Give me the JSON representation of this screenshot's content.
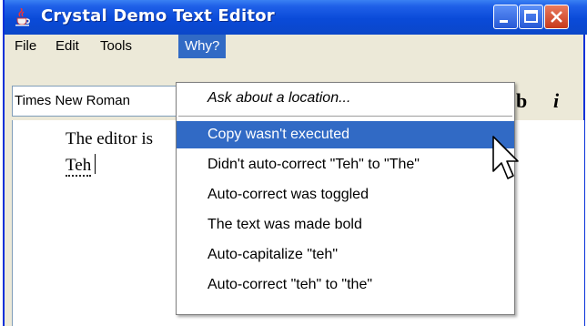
{
  "window": {
    "title": "Crystal Demo Text Editor",
    "app_icon": "java-cup-icon"
  },
  "menubar": {
    "items": [
      "File",
      "Edit",
      "Tools",
      "Why?"
    ],
    "active": "Why?"
  },
  "toolbar": {
    "font_value": "Times New Roman",
    "bold_label": "b",
    "italic_label": "i"
  },
  "editor": {
    "line1": "The editor is",
    "line2_word": "Teh"
  },
  "why_menu": {
    "ask_label": "Ask about a location...",
    "items": [
      "Copy wasn't executed",
      "Didn't auto-correct \"Teh\" to \"The\"",
      "Auto-correct was toggled",
      "The text was made bold",
      "Auto-capitalize \"teh\"",
      "Auto-correct \"teh\" to \"the\""
    ],
    "highlighted": "Copy wasn't executed"
  },
  "colors": {
    "titlebar": "#0a4ad8",
    "highlight": "#316ac5",
    "chrome": "#ece9d8"
  }
}
